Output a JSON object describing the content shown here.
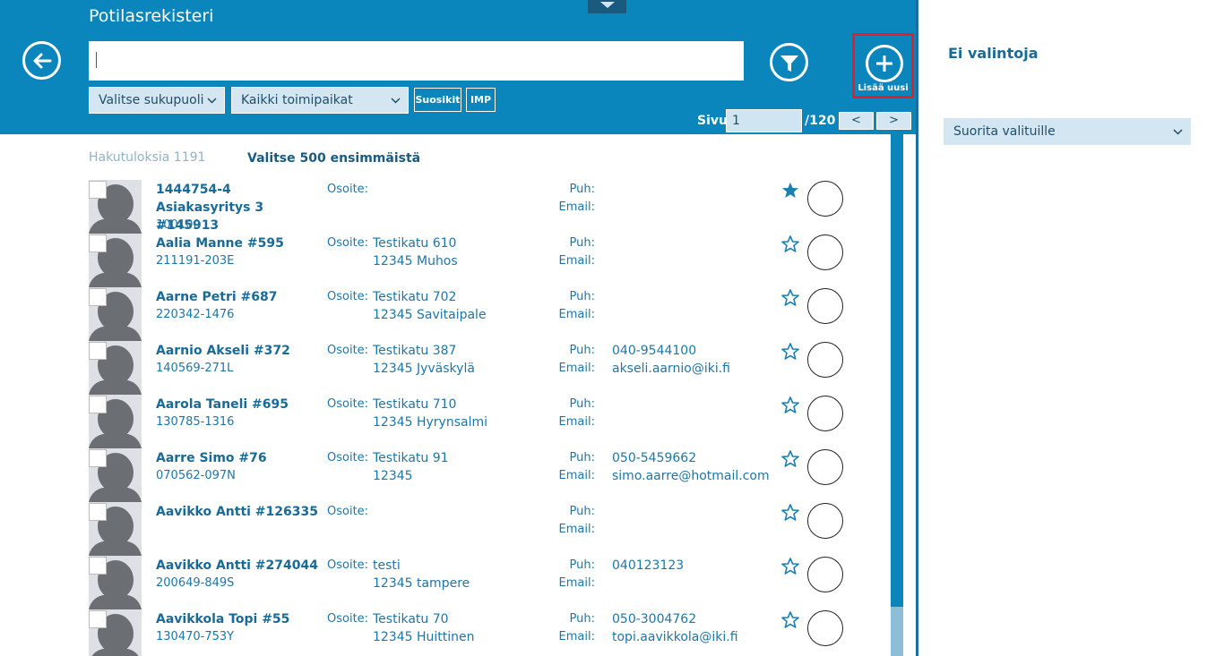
{
  "header": {
    "title": "Potilasrekisteri",
    "search_value": "",
    "add_label": "Lisää uusi",
    "gender_select": "Valitse sukupuoli",
    "location_select": "Kaikki toimipaikat",
    "chip_favorites": "Suosikit",
    "chip_imp": "IMP",
    "page_label": "Sivu",
    "page_current": "1",
    "page_total": "/120",
    "prev": "<",
    "next": ">"
  },
  "results": {
    "hits": "Hakutuloksia 1191",
    "select_first": "Valitse 500 ensimmäistä",
    "address_label": "Osoite:",
    "phone_label": "Puh:",
    "email_label": "Email:",
    "rows": [
      {
        "name": "1444754-4 Asiakasyritys 3 #145913",
        "id": "100100",
        "addr1": "",
        "addr2": "",
        "phone": "",
        "email": "",
        "favorite": true,
        "two_line": true
      },
      {
        "name": "Aalia Manne #595",
        "id": "211191-203E",
        "addr1": "Testikatu 610",
        "addr2": "12345 Muhos",
        "phone": "",
        "email": "",
        "favorite": false
      },
      {
        "name": "Aarne Petri #687",
        "id": "220342-1476",
        "addr1": "Testikatu 702",
        "addr2": "12345 Savitaipale",
        "phone": "",
        "email": "",
        "favorite": false
      },
      {
        "name": "Aarnio Akseli #372",
        "id": "140569-271L",
        "addr1": "Testikatu 387",
        "addr2": "12345 Jyväskylä",
        "phone": "040-9544100",
        "email": "akseli.aarnio@iki.fi",
        "favorite": false
      },
      {
        "name": "Aarola Taneli #695",
        "id": "130785-1316",
        "addr1": "Testikatu 710",
        "addr2": "12345 Hyrynsalmi",
        "phone": "",
        "email": "",
        "favorite": false
      },
      {
        "name": "Aarre Simo #76",
        "id": "070562-097N",
        "addr1": "Testikatu 91",
        "addr2": "12345",
        "phone": "050-5459662",
        "email": "simo.aarre@hotmail.com",
        "favorite": false
      },
      {
        "name": "Aavikko Antti #126335",
        "id": "",
        "addr1": "",
        "addr2": "",
        "phone": "",
        "email": "",
        "favorite": false
      },
      {
        "name": "Aavikko Antti #274044",
        "id": "200649-849S",
        "addr1": "testi",
        "addr2": "12345 tampere",
        "phone": "040123123",
        "email": "",
        "favorite": false
      },
      {
        "name": "Aavikkola Topi #55",
        "id": "130470-753Y",
        "addr1": "Testikatu 70",
        "addr2": "12345 Huittinen",
        "phone": "050-3004762",
        "email": "topi.aavikkola@iki.fi",
        "favorite": false
      }
    ]
  },
  "sidebar": {
    "title": "Ei valintoja",
    "action_select": "Suorita valituille"
  },
  "colors": {
    "header": "#0b86bd",
    "accent": "#1a6a98",
    "highlight": "#e12028"
  }
}
